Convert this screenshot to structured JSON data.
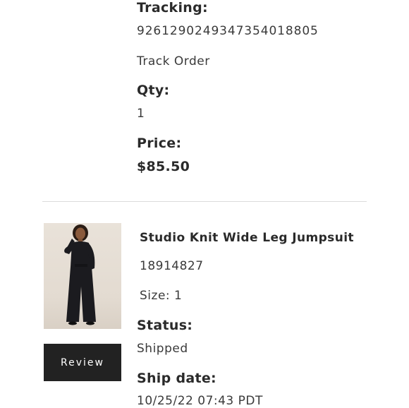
{
  "order": {
    "tracking_label": "Tracking:",
    "tracking_number": "9261290249347354018805",
    "track_order_link": "Track Order",
    "qty_label": "Qty:",
    "qty_value": "1",
    "price_label": "Price:",
    "price_value": "$85.50"
  },
  "item": {
    "name": "Studio Knit Wide Leg Jumpsuit",
    "sku": "18914827",
    "size": "Size: 1",
    "status_label": "Status:",
    "status_value": "Shipped",
    "ship_date_label": "Ship date:",
    "ship_date_value": "10/25/22 07:43 PDT",
    "review_button": "Review",
    "image_icon": "product-photo-jumpsuit"
  },
  "colors": {
    "button_bg": "#222222",
    "button_text": "#ffffff",
    "text": "#2a2a2a",
    "divider": "#dcdcdc"
  }
}
